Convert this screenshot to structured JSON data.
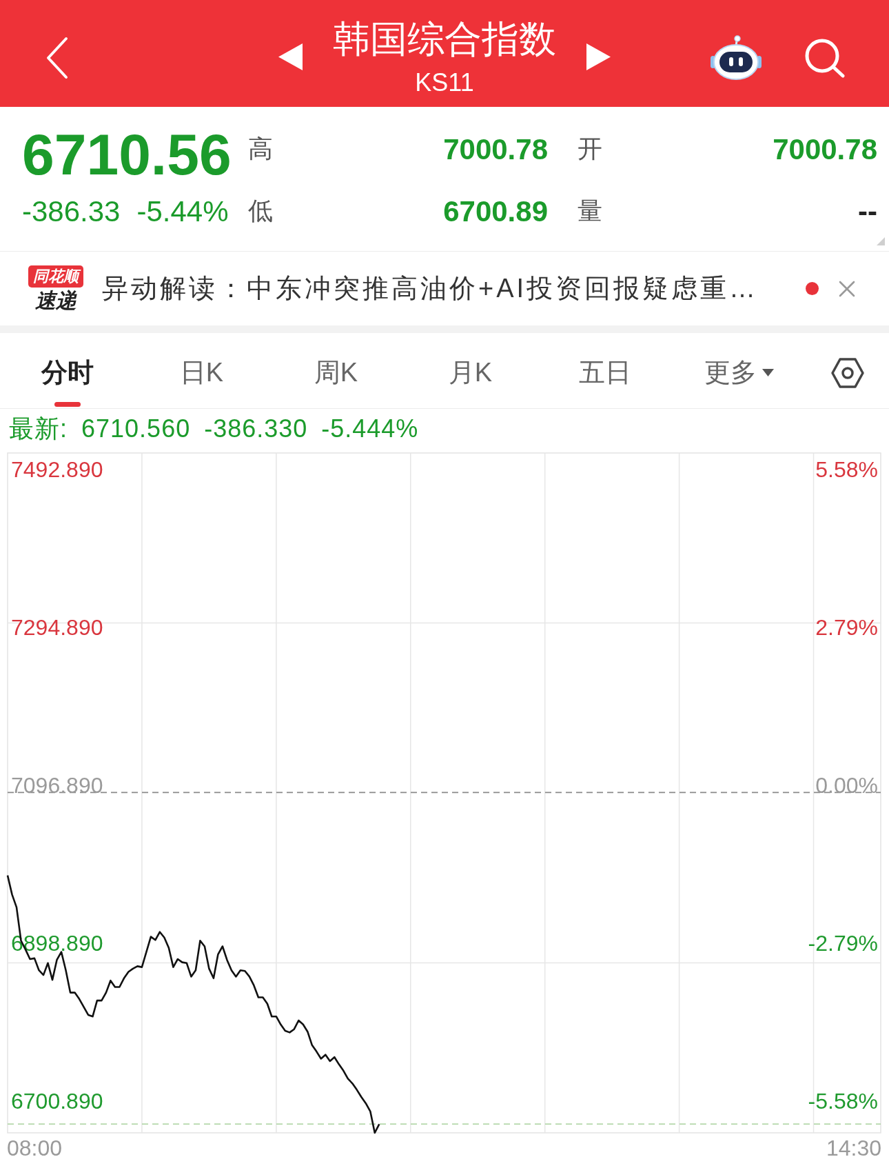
{
  "header": {
    "title": "韩国综合指数",
    "code": "KS11"
  },
  "quote": {
    "price": "6710.56",
    "change": "-386.33",
    "change_percent": "-5.44%",
    "color": "#1b9b2b",
    "stats": [
      {
        "label": "高",
        "value": "7000.78",
        "color": "#1b9b2b"
      },
      {
        "label": "开",
        "value": "7000.78",
        "color": "#1b9b2b"
      },
      {
        "label": "低",
        "value": "6700.89",
        "color": "#1b9b2b"
      },
      {
        "label": "量",
        "value": "--",
        "color": "#222222"
      }
    ]
  },
  "news": {
    "logo_top": "同花顺",
    "logo_bottom": "速递",
    "text": "异动解读：中东冲突推高油价+AI投资回报疑虑重…",
    "unread": true
  },
  "tabs": [
    {
      "label": "分时",
      "selected": true,
      "kind": "text"
    },
    {
      "label": "日K",
      "selected": false,
      "kind": "text"
    },
    {
      "label": "周K",
      "selected": false,
      "kind": "text"
    },
    {
      "label": "月K",
      "selected": false,
      "kind": "text"
    },
    {
      "label": "五日",
      "selected": false,
      "kind": "text"
    },
    {
      "label": "更多",
      "selected": false,
      "kind": "dropdown"
    }
  ],
  "chart": {
    "latest_label": "最新:",
    "latest_price": "6710.560",
    "latest_change": "-386.330",
    "latest_percent": "-5.444%",
    "right_axis_labels": [
      "5.58%",
      "2.79%",
      "0.00%",
      "-2.79%",
      "-5.58%"
    ],
    "chart_data": {
      "type": "line",
      "categories": [
        null,
        null,
        null,
        null,
        null,
        null,
        "08:00",
        null,
        null,
        null,
        null,
        null,
        null,
        null,
        null,
        null,
        null,
        null,
        null,
        null,
        null,
        null,
        null,
        null,
        null,
        null,
        null,
        null,
        null,
        null,
        null,
        null,
        null,
        null,
        null,
        null,
        null,
        null,
        null,
        null,
        null,
        null,
        null,
        null,
        null,
        null,
        null,
        null,
        null,
        null,
        null,
        null,
        null,
        null,
        null,
        null,
        null,
        null,
        null,
        null,
        null,
        null,
        null,
        null,
        null,
        null,
        null,
        null,
        null,
        null,
        null,
        null,
        null,
        null,
        null,
        null,
        null,
        null,
        null,
        null,
        null,
        null,
        null,
        null,
        null,
        null,
        null,
        null,
        null,
        null,
        null,
        null,
        null,
        null,
        null,
        null,
        null,
        null,
        null,
        null,
        null,
        null,
        null,
        null,
        null,
        null,
        null,
        null,
        null,
        null,
        null,
        null,
        null,
        null,
        null,
        null,
        null,
        null,
        null,
        null,
        null,
        null,
        null,
        null,
        null,
        null,
        null,
        null,
        null,
        null,
        null,
        null,
        null,
        null,
        null,
        null,
        null,
        null,
        null,
        null,
        null,
        null,
        null,
        null,
        null,
        null,
        null,
        null,
        null,
        null,
        null,
        null,
        null,
        null,
        null,
        null,
        null,
        null,
        null,
        null,
        null,
        null,
        null,
        null,
        null,
        null,
        null,
        null,
        null,
        null,
        null,
        null,
        null,
        null,
        null,
        null,
        null,
        null,
        null,
        null,
        null,
        null,
        null,
        null,
        null,
        null,
        null,
        null,
        null,
        "14:30",
        null,
        null,
        null,
        null,
        null,
        null
      ],
      "series": [
        {
          "color": "#111111",
          "values": [
            6984,
            6960,
            6944,
            6902,
            6891,
            6879,
            6880,
            6865,
            6859,
            6874,
            6853,
            6878,
            6888,
            6865,
            6837,
            6837,
            6829,
            6819,
            6809,
            6807,
            6827,
            6827,
            6837,
            6852,
            6844,
            6844,
            6855,
            6863,
            6867,
            6870,
            6869,
            6888,
            6907,
            6903,
            6913,
            6906,
            6893,
            6869,
            6879,
            6875,
            6874,
            6857,
            6865,
            6902,
            6895,
            6867,
            6855,
            6885,
            6895,
            6878,
            6865,
            6857,
            6865,
            6864,
            6857,
            6846,
            6831,
            6831,
            6823,
            6807,
            6807,
            6797,
            6789,
            6787,
            6791,
            6802,
            6797,
            6788,
            6771,
            6763,
            6754,
            6759,
            6751,
            6756,
            6747,
            6739,
            6729,
            6723,
            6715,
            6706,
            6698,
            6688,
            6661,
            6672,
            null,
            null,
            null,
            null,
            null,
            null,
            null,
            null,
            null,
            null,
            null,
            null,
            null,
            null,
            null,
            null,
            null,
            null,
            null,
            null,
            null,
            null,
            null,
            null,
            null,
            null,
            null,
            null,
            null,
            null,
            null,
            null,
            null,
            null,
            null,
            null,
            null,
            null,
            null,
            null,
            null,
            null,
            null,
            null,
            null,
            null,
            null,
            null,
            null,
            null,
            null,
            null,
            null,
            null,
            null,
            null,
            null,
            null,
            null,
            null,
            null,
            null,
            null,
            null,
            null,
            null,
            null,
            null,
            null,
            null,
            null,
            null,
            null,
            null,
            null,
            null,
            null,
            null,
            null,
            null,
            null,
            null,
            null,
            null,
            null,
            null,
            null,
            null,
            null,
            null,
            null,
            null,
            null,
            null,
            null,
            null,
            null,
            null,
            null,
            null,
            null,
            null,
            null,
            null,
            null,
            null,
            null,
            null,
            null,
            null,
            null,
            null
          ]
        }
      ],
      "ylim": [
        6661,
        7514
      ],
      "yticks": [
        {
          "value": 7492.89,
          "label": "7492.890"
        },
        {
          "value": 7294.89,
          "label": "7294.890"
        },
        {
          "value": 7096.89,
          "label": "7096.890"
        },
        {
          "value": 6898.89,
          "label": "6898.890"
        },
        {
          "value": 6700.89,
          "label": "6700.890"
        }
      ],
      "ref_lines": [
        {
          "axis": "y",
          "value": 7088,
          "color": "#8a8a8a"
        },
        {
          "axis": "y",
          "value": 6672,
          "color": "#a9d29e"
        }
      ]
    }
  }
}
